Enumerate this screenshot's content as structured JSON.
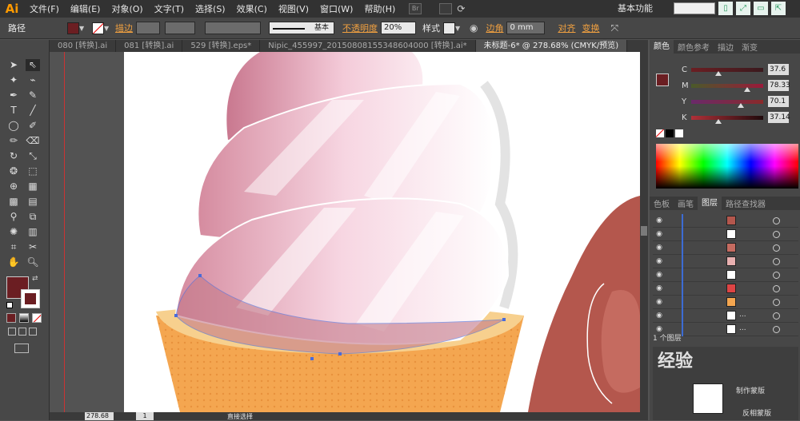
{
  "app": {
    "logo": "Ai",
    "workspace": "基本功能"
  },
  "menu": [
    "文件(F)",
    "编辑(E)",
    "对象(O)",
    "文字(T)",
    "选择(S)",
    "效果(C)",
    "视图(V)",
    "窗口(W)",
    "帮助(H)"
  ],
  "menu_box": "Br",
  "control": {
    "path_label": "路径",
    "stroke_label": "描边",
    "stroke_style": "基本",
    "opacity_label": "不透明度",
    "opacity_value": "20%",
    "style_label": "样式",
    "corner_label": "边角",
    "corner_value": "0 mm",
    "align_label": "对齐",
    "transform_label": "变换",
    "fill_color": "#6b1e22"
  },
  "tabs": [
    {
      "label": "080 [转换].ai",
      "active": false
    },
    {
      "label": "081 [转换].ai",
      "active": false
    },
    {
      "label": "529 [转换].eps*",
      "active": false
    },
    {
      "label": "Nipic_455997_20150808155348604000 [转换].ai*",
      "active": false
    },
    {
      "label": "未标题-6* @ 278.68% (CMYK/预览)",
      "active": true
    }
  ],
  "status": {
    "zoom": "278.68",
    "page": "1",
    "tool": "直接选择"
  },
  "color_panel": {
    "tabs": [
      "颜色",
      "颜色参考",
      "描边",
      "渐变"
    ],
    "cmyk": [
      {
        "letter": "C",
        "value": "37.6",
        "pos": 0.38
      },
      {
        "letter": "M",
        "value": "78.33",
        "pos": 0.78
      },
      {
        "letter": "Y",
        "value": "70.1",
        "pos": 0.7
      },
      {
        "letter": "K",
        "value": "37.14",
        "pos": 0.37
      }
    ]
  },
  "layers_panel": {
    "tabs": [
      "色板",
      "画笔",
      "图层",
      "路径查找器"
    ],
    "rows": [
      "",
      "",
      "",
      "",
      "",
      "",
      "",
      "...",
      "..."
    ],
    "footer": "1 个图层"
  },
  "bottom_panel": {
    "labels": [
      "制作蒙版",
      "反相蒙版"
    ]
  },
  "watermark": "经验"
}
